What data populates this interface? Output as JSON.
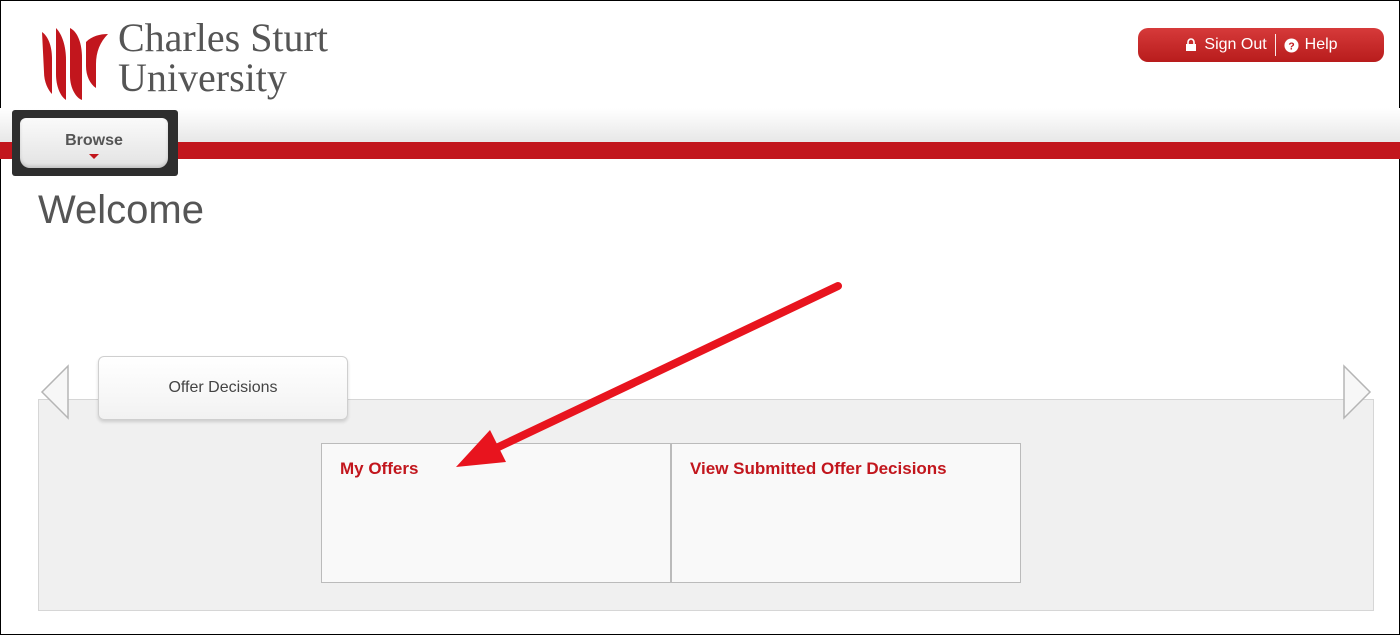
{
  "header": {
    "logo_line1": "Charles Sturt",
    "logo_line2": "University",
    "sign_out": "Sign Out",
    "help": "Help"
  },
  "nav": {
    "browse": "Browse"
  },
  "page": {
    "title": "Welcome"
  },
  "tabs": [
    {
      "label": "Offer Decisions"
    }
  ],
  "tiles": [
    {
      "label": "My Offers"
    },
    {
      "label": "View Submitted Offer Decisions"
    }
  ],
  "colors": {
    "brand_red": "#c2161d",
    "annotation_red": "#e8141e"
  }
}
